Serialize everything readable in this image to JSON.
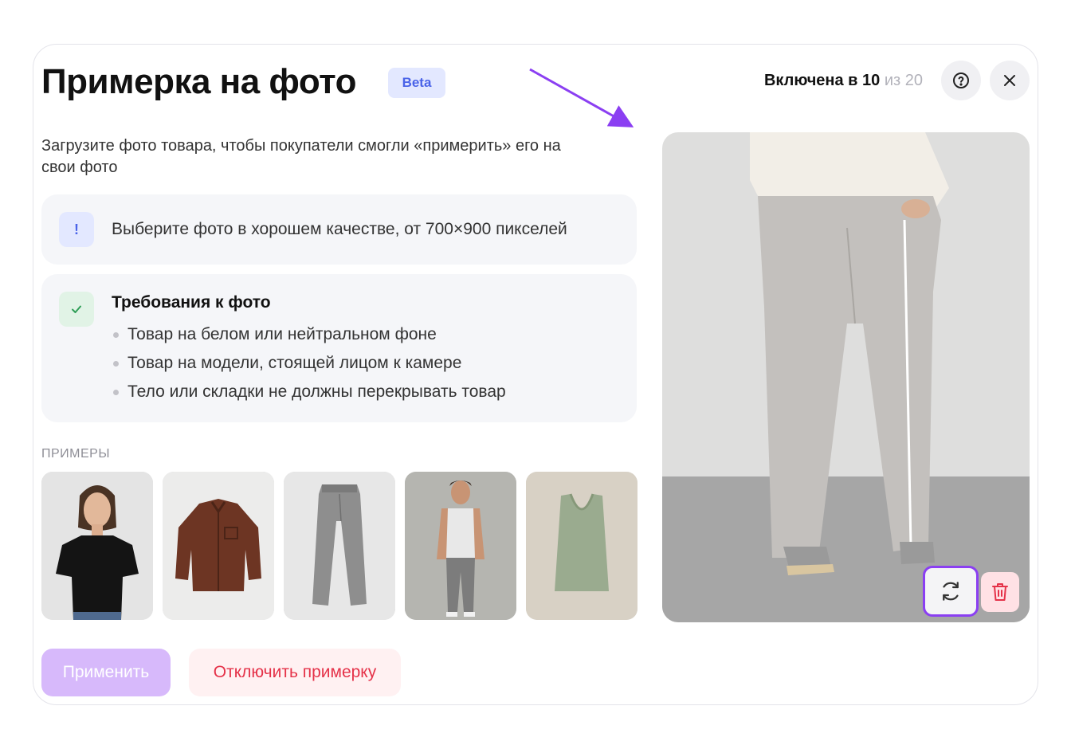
{
  "header": {
    "title": "Примерка на фото",
    "badge": "Beta",
    "status_prefix": "Включена в 10",
    "status_suffix": "из 20",
    "help_icon": "question-circle-icon",
    "close_icon": "close-icon"
  },
  "subtitle": "Загрузите фото товара, чтобы покупатели смогли «примерить» его на свои фото",
  "notice": {
    "icon_text": "!",
    "text": "Выберите фото в хорошем качестве, от 700×900 пикселей"
  },
  "requirements": {
    "icon": "check-icon",
    "title": "Требования к фото",
    "items": [
      "Товар на белом или нейтральном фоне",
      "Товар на модели, стоящей лицом к камере",
      "Тело или складки не должны перекрывать товар"
    ]
  },
  "examples": {
    "label": "ПРИМЕРЫ",
    "items": [
      "woman-black-tshirt-photo",
      "brown-jacket-photo",
      "gray-jeans-photo",
      "man-tank-top-photo",
      "green-tank-top-photo"
    ]
  },
  "actions": {
    "apply_label": "Применить",
    "disable_label": "Отключить примерку"
  },
  "preview": {
    "image": "gray-trousers-photo",
    "refresh_icon": "refresh-icon",
    "delete_icon": "trash-icon"
  },
  "colors": {
    "accent": "#8b3ff2",
    "apply_bg": "#d7b9fb",
    "danger": "#e53249",
    "badge_bg": "#e3e8ff",
    "badge_text": "#4a63e8"
  }
}
